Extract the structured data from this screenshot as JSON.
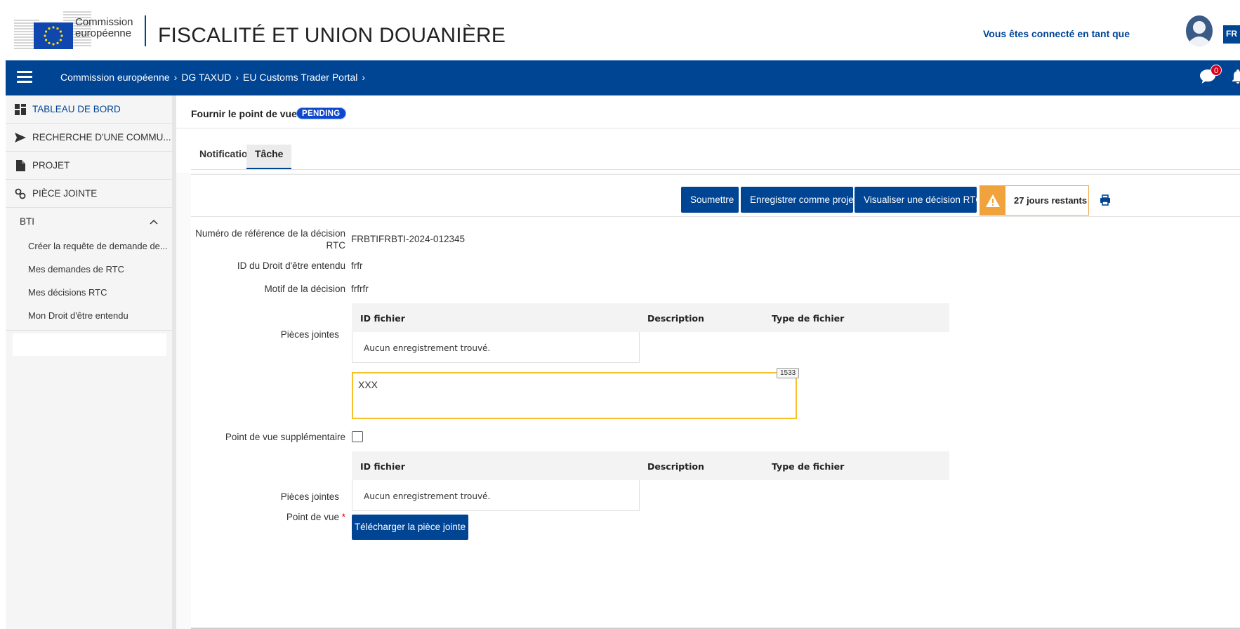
{
  "header": {
    "logo_line1": "Commission",
    "logo_line2": "européenne",
    "site_title": "FISCALITÉ ET UNION DOUANIÈRE",
    "connected_text": "Vous êtes connecté en tant que",
    "language": "FR"
  },
  "navbar": {
    "breadcrumb": [
      "Commission européenne",
      "DG TAXUD",
      "EU Customs Trader Portal"
    ],
    "separator": "›",
    "notification_count": "0"
  },
  "sidebar": {
    "items": [
      {
        "label": "TABLEAU DE BORD",
        "icon": "dashboard-icon"
      },
      {
        "label": "RECHERCHE D'UNE COMMU...",
        "icon": "send-icon"
      },
      {
        "label": "PROJET",
        "icon": "file-icon"
      },
      {
        "label": "PIÈCE JOINTE",
        "icon": "link-icon"
      }
    ],
    "section": {
      "label": "BTI",
      "icon": "chevron-up-icon"
    },
    "sub_items": [
      "Créer la requête de demande de...",
      "Mes demandes de RTC",
      "Mes décisions RTC",
      "Mon Droit d'être entendu"
    ]
  },
  "page": {
    "title": "Fournir le point de vue",
    "status": "PENDING"
  },
  "tabs": [
    "Notification",
    "Tâche"
  ],
  "actions": {
    "submit": "Soumettre",
    "save_draft": "Enregistrer comme projet",
    "view_decision": "Visualiser une décision RTC",
    "days_remaining": "27 jours restants"
  },
  "form": {
    "ref_label_line1": "Numéro de référence de la décision",
    "ref_label_line2": "RTC",
    "ref_value": "FRBTIFRBTI-2024-012345",
    "right_id_label": "ID du Droit d'être entendu",
    "right_id_value": "frfr",
    "reason_label": "Motif de la décision",
    "reason_value": "frfrfr",
    "attachments_label": "Pièces jointes",
    "table_headers": [
      "ID fichier",
      "Description",
      "Type de fichier"
    ],
    "empty_text": "Aucun enregistrement trouvé.",
    "viewpoint_label": "Point de vue",
    "required_mark": "*",
    "viewpoint_value": "XXX",
    "char_count": "1533",
    "extra_viewpoint_label": "Point de vue supplémentaire",
    "upload_button": "Télécharger la pièce jointe"
  },
  "colors": {
    "brand_blue": "#004494",
    "pending_blue": "#0e47cb",
    "warning_orange": "#f0a23c",
    "focus_yellow": "#f5c02a"
  }
}
